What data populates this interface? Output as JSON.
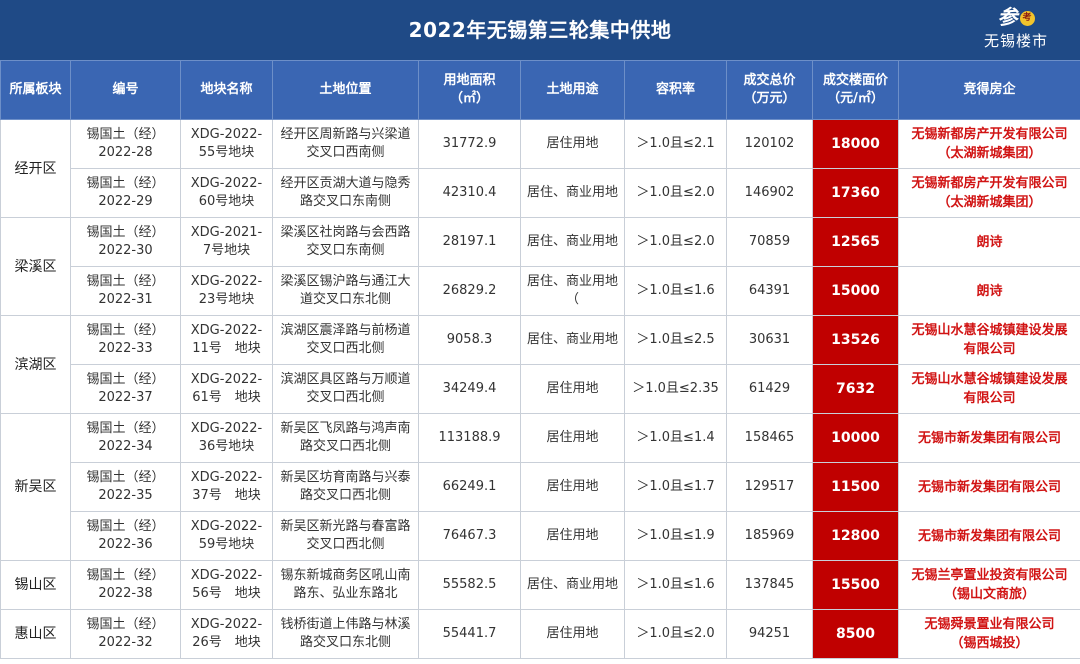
{
  "title": "2022年无锡第三轮集中供地",
  "logo": {
    "mark": "参",
    "badge": "考",
    "text": "无锡楼市"
  },
  "colors": {
    "header_bar": "#1f4a86",
    "table_header": "#3a66b3",
    "price_cell": "#c00000",
    "developer_text": "#d11414"
  },
  "headers": [
    "所属板块",
    "编号",
    "地块名称",
    "土地位置",
    "用地面积\n（㎡）",
    "土地用途",
    "容积率",
    "成交总价\n（万元）",
    "成交楼面价\n（元/㎡）",
    "竞得房企"
  ],
  "regions": [
    "经开区",
    "梁溪区",
    "滨湖区",
    "新吴区",
    "锡山区",
    "惠山区"
  ],
  "rows": [
    {
      "id": "锡国土（经）\n2022-28",
      "name": "XDG-2022-\n55号地块",
      "location": "经开区周新路与兴梁道\n交叉口西南侧",
      "area": "31772.9",
      "use": "居住用地",
      "far": "＞1.0且≤2.1",
      "total": "120102",
      "price": "18000",
      "developer": "无锡新都房产开发有限公司\n（太湖新城集团）"
    },
    {
      "id": "锡国土（经）\n2022-29",
      "name": "XDG-2022-\n60号地块",
      "location": "经开区贡湖大道与隐秀\n路交叉口东南侧",
      "area": "42310.4",
      "use": "居住、商业用地",
      "far": "＞1.0且≤2.0",
      "total": "146902",
      "price": "17360",
      "developer": "无锡新都房产开发有限公司\n（太湖新城集团）"
    },
    {
      "id": "锡国土（经）\n2022-30",
      "name": "XDG-2021-\n7号地块",
      "location": "梁溪区社岗路与会西路\n交叉口东南侧",
      "area": "28197.1",
      "use": "居住、商业用地",
      "far": "＞1.0且≤2.0",
      "total": "70859",
      "price": "12565",
      "developer": "朗诗"
    },
    {
      "id": "锡国土（经）\n2022-31",
      "name": "XDG-2022-\n23号地块",
      "location": "梁溪区锡沪路与通江大\n道交叉口东北侧",
      "area": "26829.2",
      "use": "居住、商业用地\n（",
      "far": "＞1.0且≤1.6",
      "total": "64391",
      "price": "15000",
      "developer": "朗诗"
    },
    {
      "id": "锡国土（经）\n2022-33",
      "name": "XDG-2022-\n11号　地块",
      "location": "滨湖区震泽路与前杨道\n交叉口西北侧",
      "area": "9058.3",
      "use": "居住、商业用地",
      "far": "＞1.0且≤2.5",
      "total": "30631",
      "price": "13526",
      "developer": "无锡山水慧谷城镇建设发展\n有限公司"
    },
    {
      "id": "锡国土（经）\n2022-37",
      "name": "XDG-2022-\n61号　地块",
      "location": "滨湖区具区路与万顺道\n交叉口西北侧",
      "area": "34249.4",
      "use": "居住用地",
      "far": "＞1.0且≤2.35",
      "total": "61429",
      "price": "7632",
      "developer": "无锡山水慧谷城镇建设发展\n有限公司"
    },
    {
      "id": "锡国土（经）\n2022-34",
      "name": "XDG-2022-\n36号地块",
      "location": "新吴区飞凤路与鸿声南\n路交叉口西北侧",
      "area": "113188.9",
      "use": "居住用地",
      "far": "＞1.0且≤1.4",
      "total": "158465",
      "price": "10000",
      "developer": "无锡市新发集团有限公司"
    },
    {
      "id": "锡国土（经）\n2022-35",
      "name": "XDG-2022-\n37号　地块",
      "location": "新吴区坊育南路与兴泰\n路交叉口西北侧",
      "area": "66249.1",
      "use": "居住用地",
      "far": "＞1.0且≤1.7",
      "total": "129517",
      "price": "11500",
      "developer": "无锡市新发集团有限公司"
    },
    {
      "id": "锡国土（经）\n2022-36",
      "name": "XDG-2022-\n59号地块",
      "location": "新吴区新光路与春富路\n交叉口西北侧",
      "area": "76467.3",
      "use": "居住用地",
      "far": "＞1.0且≤1.9",
      "total": "185969",
      "price": "12800",
      "developer": "无锡市新发集团有限公司"
    },
    {
      "id": "锡国土（经）\n2022-38",
      "name": "XDG-2022-\n56号　地块",
      "location": "锡东新城商务区吼山南\n路东、弘业东路北",
      "area": "55582.5",
      "use": "居住、商业用地",
      "far": "＞1.0且≤1.6",
      "total": "137845",
      "price": "15500",
      "developer": "无锡兰亭置业投资有限公司\n（锡山文商旅）"
    },
    {
      "id": "锡国土（经）\n2022-32",
      "name": "XDG-2022-\n26号　地块",
      "location": "钱桥街道上伟路与林溪\n路交叉口东北侧",
      "area": "55441.7",
      "use": "居住用地",
      "far": "＞1.0且≤2.0",
      "total": "94251",
      "price": "8500",
      "developer": "无锡舜景置业有限公司\n（锡西城投）"
    }
  ]
}
